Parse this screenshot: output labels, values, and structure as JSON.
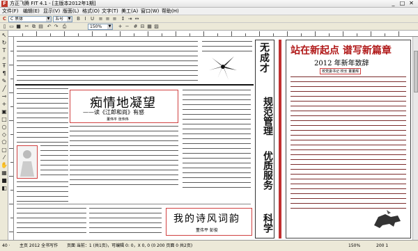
{
  "window": {
    "title": "方正飞腾 FIT 4.1 - [主版本2012年1期]",
    "minimize": "_",
    "maximize": "□",
    "close": "✕"
  },
  "menu": [
    "文件(F)",
    "编辑(E)",
    "显示(V)",
    "版面(L)",
    "格式(O)",
    "文字(T)",
    "美工(A)",
    "窗口(W)",
    "帮助(H)"
  ],
  "toolbar2": {
    "font_field": "C 黑体",
    "font_field2": "1 黑体",
    "size_field": "五号",
    "zoom_field": "150%"
  },
  "article1": {
    "headline": "痴情地凝望",
    "subhead": "——读《江郎和尚》有感",
    "byline": "董伟平  张伟伟"
  },
  "vertical_banner": {
    "line1": "无成才",
    "line2": "规范管理",
    "line3": "优质服务",
    "line4": "科学"
  },
  "article2": {
    "headline": "站在新起点  谱写新篇章",
    "subhead": "2012 年新年致辞",
    "byline": "校党委书记  校长  董董辉"
  },
  "article3": {
    "headline": "我的诗风词韵",
    "byline": "董伟平  彭俊"
  },
  "status": {
    "left": "40 ·",
    "mode": "主页 2012 全书写作",
    "info": "页面 当前：1 (共1页)，可编辑 0: 0，X 0, 0 (0 200 页面 0 共2页)",
    "zoom": "150%",
    "pos": "200 1"
  }
}
